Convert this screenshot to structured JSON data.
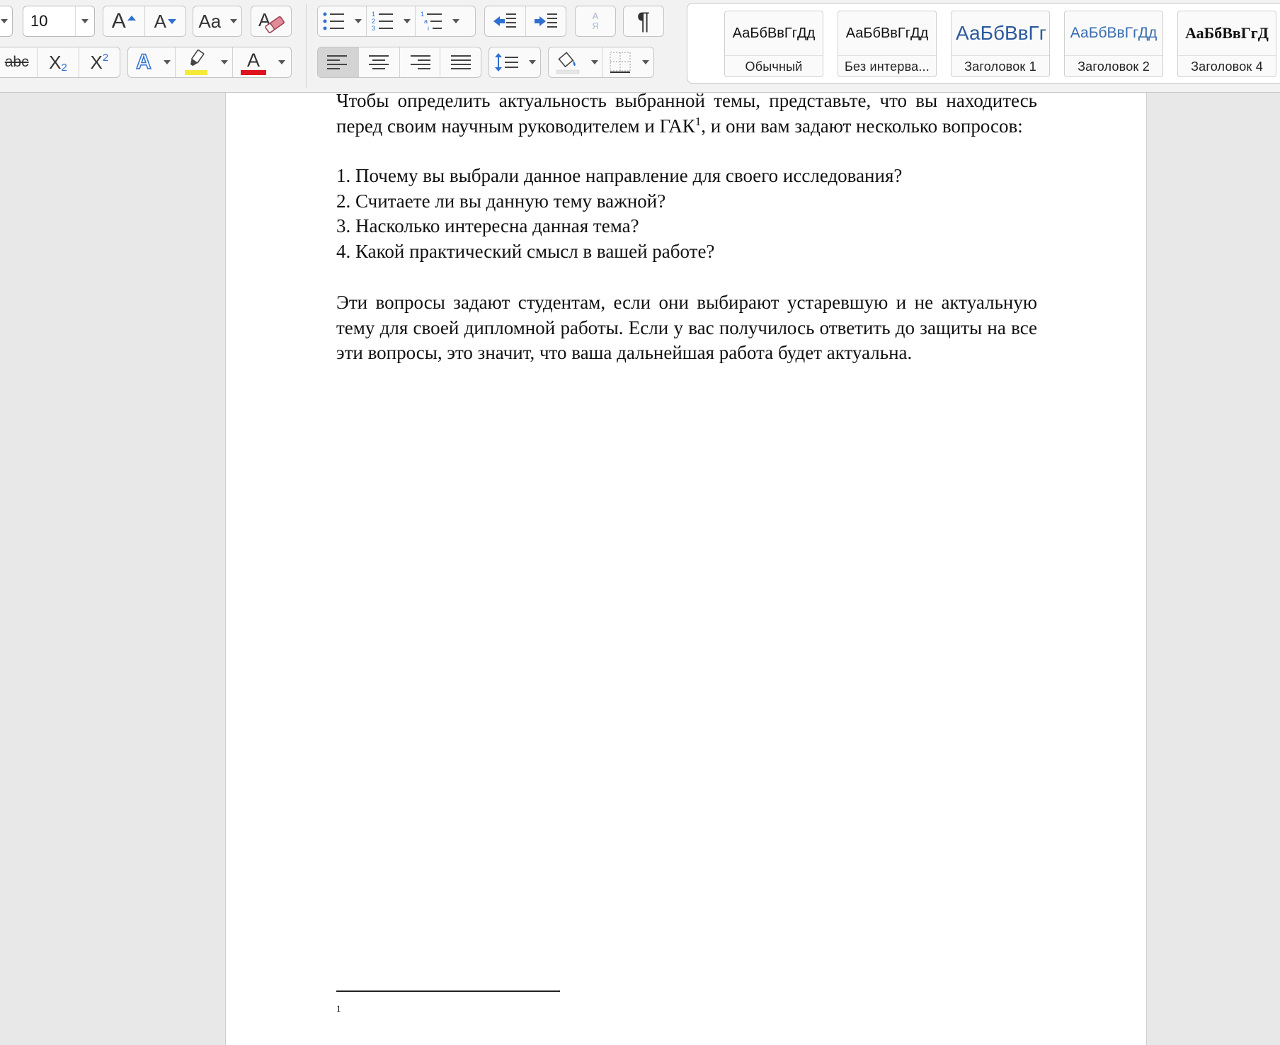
{
  "ribbon": {
    "font_size": "10",
    "grow_font_label": "A",
    "shrink_font_label": "A",
    "change_case_label": "Aa",
    "strikethrough_label": "abc",
    "subscript_label": "X",
    "subscript_mark": "2",
    "superscript_label": "X",
    "superscript_mark": "2",
    "text_effects_label": "A",
    "font_color_label": "A",
    "sort_label_top": "А",
    "sort_label_bottom": "Я",
    "pilcrow_label": "¶",
    "highlight_color": "#f5e93a",
    "font_color": "#e0141e",
    "accent_blue": "#2f6fd1"
  },
  "styles": [
    {
      "preview": "АаБбВвГгДд",
      "label": "Обычный"
    },
    {
      "preview": "АаБбВвГгДд",
      "label": "Без интерва..."
    },
    {
      "preview": "АаБбВвГг",
      "label": "Заголовок 1"
    },
    {
      "preview": "АаБбВвГгДд",
      "label": "Заголовок 2"
    },
    {
      "preview": "АаБбВвГгД",
      "label": "Заголовок 4"
    }
  ],
  "document": {
    "para1_before": "Чтобы определить актуальность выбранной темы, представьте, что вы находитесь перед своим научным руководителем и ГАК",
    "para1_fn": "1",
    "para1_after": ", и они вам задают несколько вопросов:",
    "list": [
      "1. Почему вы выбрали данное направление для своего исследования?",
      "2. Считаете ли вы данную тему важной?",
      "3. Насколько интересна данная тема?",
      "4. Какой практический смысл в вашей работе?"
    ],
    "para2": "Эти вопросы задают студентам, если они выбирают устаревшую и не актуальную тему для своей дипломной работы. Если у вас получилось ответить до защиты на все эти вопросы, это значит, что ваша дальнейшая работа будет актуальна.",
    "footnote_number": "1"
  }
}
